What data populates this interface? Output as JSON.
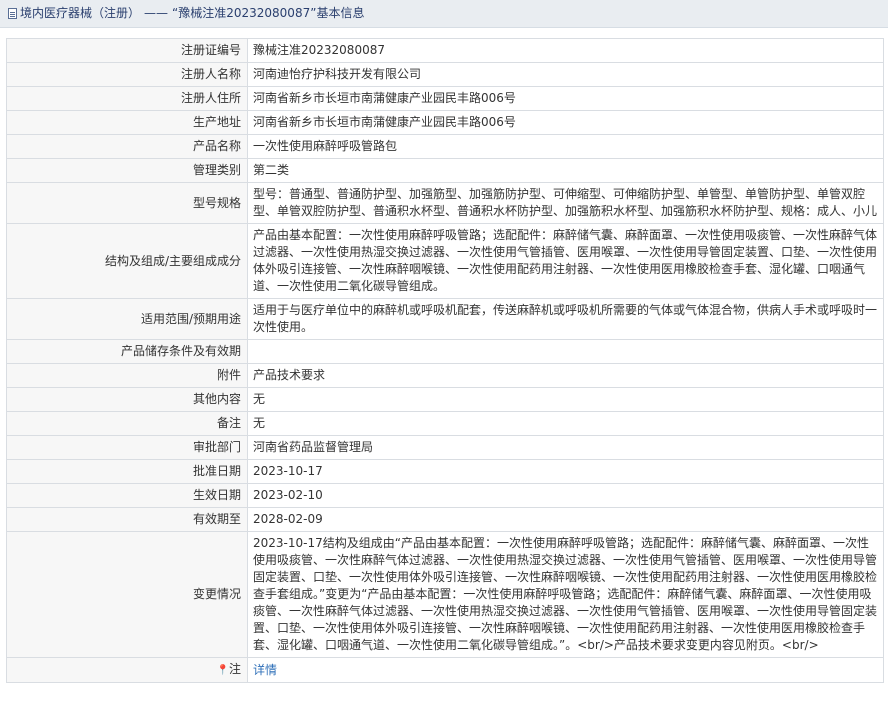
{
  "title": {
    "category": "境内医疗器械（注册）",
    "separator": "——",
    "reg_title": "“豫械注准20232080087”",
    "suffix": "基本信息"
  },
  "rows": [
    {
      "label": "注册证编号",
      "value": "豫械注准20232080087"
    },
    {
      "label": "注册人名称",
      "value": "河南迪怡疗护科技开发有限公司"
    },
    {
      "label": "注册人住所",
      "value": "河南省新乡市长垣市南蒲健康产业园民丰路006号"
    },
    {
      "label": "生产地址",
      "value": "河南省新乡市长垣市南蒲健康产业园民丰路006号"
    },
    {
      "label": "产品名称",
      "value": "一次性使用麻醉呼吸管路包"
    },
    {
      "label": "管理类别",
      "value": "第二类"
    },
    {
      "label": "型号规格",
      "value": "型号：普通型、普通防护型、加强筋型、加强筋防护型、可伸缩型、可伸缩防护型、单管型、单管防护型、单管双腔型、单管双腔防护型、普通积水杯型、普通积水杯防护型、加强筋积水杯型、加强筋积水杯防护型、规格：成人、小儿"
    },
    {
      "label": "结构及组成/主要组成成分",
      "value": "产品由基本配置：一次性使用麻醉呼吸管路；选配配件：麻醉储气囊、麻醉面罩、一次性使用吸痰管、一次性麻醉气体过滤器、一次性使用热湿交换过滤器、一次性使用气管插管、医用喉罩、一次性使用导管固定装置、口垫、一次性使用体外吸引连接管、一次性麻醉咽喉镜、一次性使用配药用注射器、一次性使用医用橡胶检查手套、湿化罐、口咽通气道、一次性使用二氧化碳导管组成。"
    },
    {
      "label": "适用范围/预期用途",
      "value": "适用于与医疗单位中的麻醉机或呼吸机配套，传送麻醉机或呼吸机所需要的气体或气体混合物，供病人手术或呼吸时一次性使用。"
    },
    {
      "label": "产品储存条件及有效期",
      "value": ""
    },
    {
      "label": "附件",
      "value": "产品技术要求"
    },
    {
      "label": "其他内容",
      "value": "无"
    },
    {
      "label": "备注",
      "value": "无"
    },
    {
      "label": "审批部门",
      "value": "河南省药品监督管理局"
    },
    {
      "label": "批准日期",
      "value": "2023-10-17"
    },
    {
      "label": "生效日期",
      "value": "2023-02-10"
    },
    {
      "label": "有效期至",
      "value": "2028-02-09"
    },
    {
      "label": "变更情况",
      "value": "2023-10-17结构及组成由“产品由基本配置：一次性使用麻醉呼吸管路；选配配件：麻醉储气囊、麻醉面罩、一次性使用吸痰管、一次性麻醉气体过滤器、一次性使用热湿交换过滤器、一次性使用气管插管、医用喉罩、一次性使用导管固定装置、口垫、一次性使用体外吸引连接管、一次性麻醉咽喉镜、一次性使用配药用注射器、一次性使用医用橡胶检查手套组成。”变更为“产品由基本配置：一次性使用麻醉呼吸管路；选配配件：麻醉储气囊、麻醉面罩、一次性使用吸痰管、一次性麻醉气体过滤器、一次性使用热湿交换过滤器、一次性使用气管插管、医用喉罩、一次性使用导管固定装置、口垫、一次性使用体外吸引连接管、一次性麻醉咽喉镜、一次性使用配药用注射器、一次性使用医用橡胶检查手套、湿化罐、口咽通气道、一次性使用二氧化碳导管组成。”。<br/>产品技术要求变更内容见附页。<br/>"
    }
  ],
  "note": {
    "icon": "pin-icon",
    "label": "注",
    "link_text": "详情"
  }
}
